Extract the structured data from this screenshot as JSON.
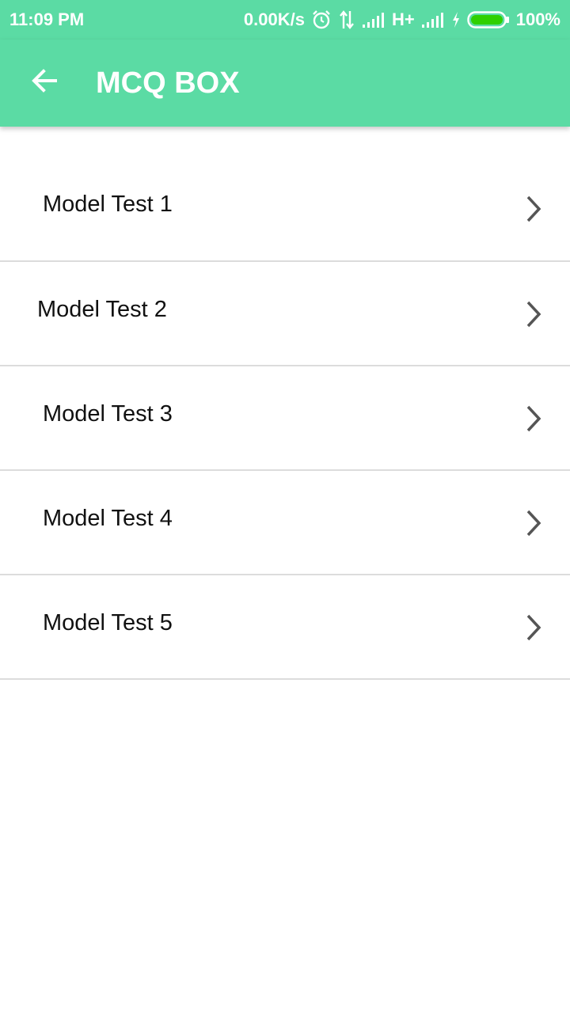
{
  "status_bar": {
    "time": "11:09 PM",
    "network_speed": "0.00K/s",
    "network_type": "H+",
    "battery": "100%",
    "icons": [
      "alarm-icon",
      "data-transfer-icon",
      "signal-icon",
      "signal-icon",
      "charging-icon",
      "battery-icon"
    ]
  },
  "app_bar": {
    "title": "MCQ BOX",
    "back_icon": "arrow-back-icon"
  },
  "list": {
    "items": [
      {
        "label": "Model Test 1"
      },
      {
        "label": "Model Test 2"
      },
      {
        "label": "Model Test 3"
      },
      {
        "label": "Model Test 4"
      },
      {
        "label": "Model Test 5"
      }
    ],
    "item_icon": "chevron-right-icon"
  },
  "colors": {
    "primary": "#5bdba4",
    "divider": "#dcdcdc",
    "text": "#111111",
    "battery_fill": "#2fd000"
  }
}
